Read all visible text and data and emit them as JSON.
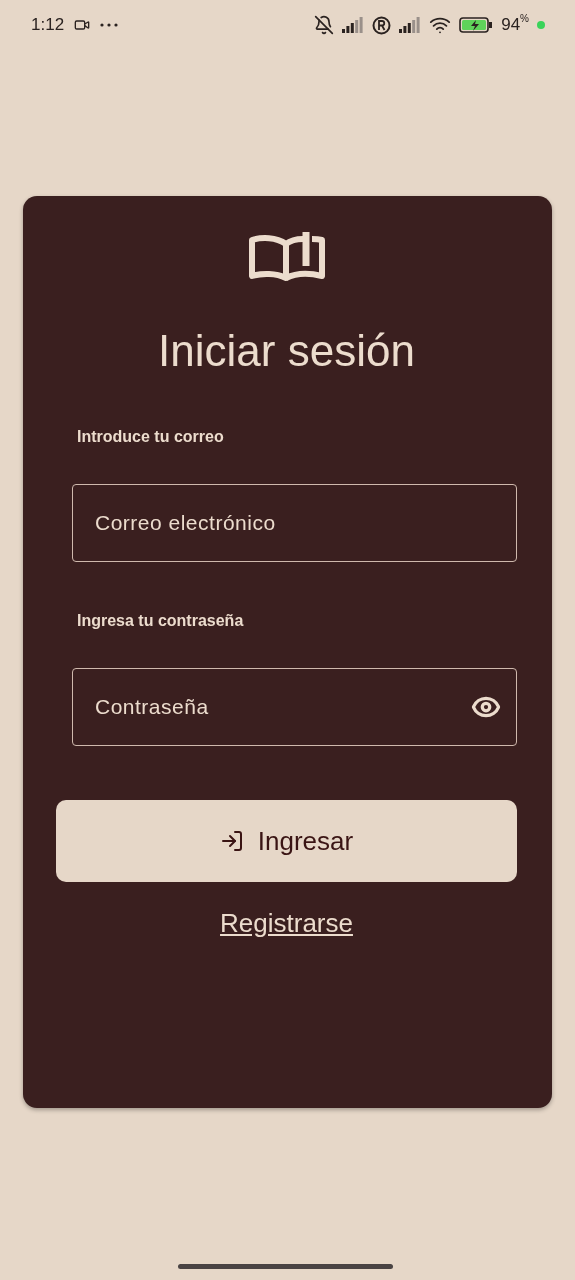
{
  "status_bar": {
    "time": "1:12",
    "battery_percent": "94",
    "percent_sign": "%"
  },
  "login": {
    "title": "Iniciar sesión",
    "fields": [
      {
        "label": "Introduce tu correo",
        "placeholder": "Correo electrónico",
        "kind": "text"
      },
      {
        "label": "Ingresa tu contraseña",
        "placeholder": "Contraseña",
        "kind": "password"
      }
    ],
    "submit": "Ingresar",
    "register_link": "Registrarse"
  }
}
